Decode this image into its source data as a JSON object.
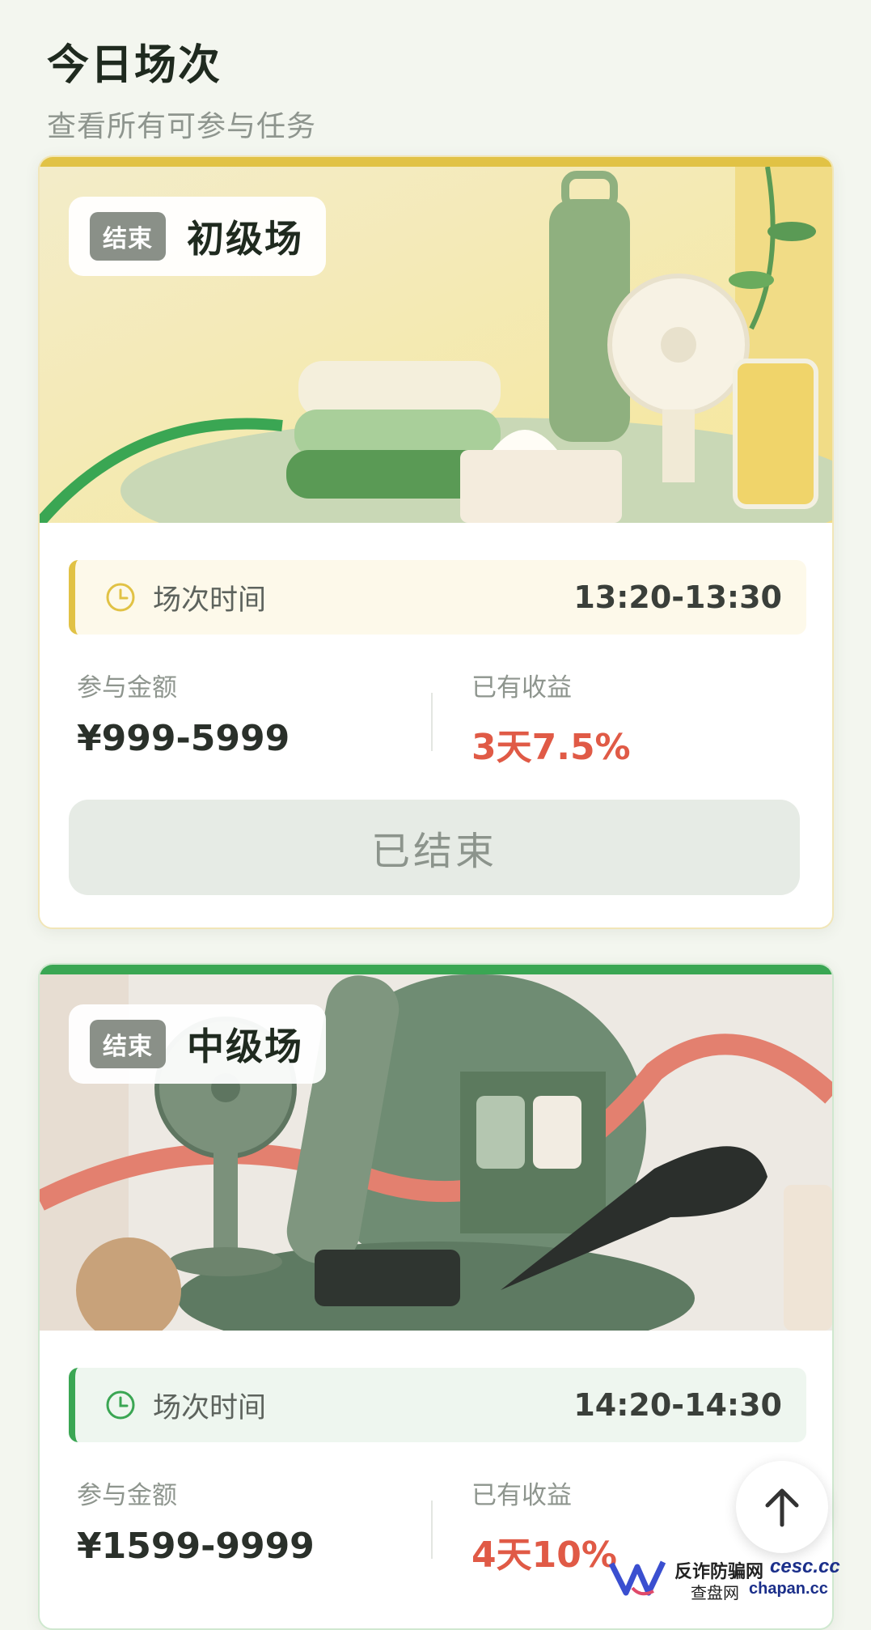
{
  "header": {
    "title": "今日场次",
    "subtitle": "查看所有可参与任务"
  },
  "sessions": [
    {
      "status_badge": "结束",
      "level": "初级场",
      "time_label": "场次时间",
      "time_value": "13:20-13:30",
      "amount_label": "参与金额",
      "amount_value": "¥999-5999",
      "profit_label": "已有收益",
      "profit_value": "3天7.5%",
      "button_label": "已结束",
      "accent_color": "#e1c245"
    },
    {
      "status_badge": "结束",
      "level": "中级场",
      "time_label": "场次时间",
      "time_value": "14:20-14:30",
      "amount_label": "参与金额",
      "amount_value": "¥1599-9999",
      "profit_label": "已有收益",
      "profit_value": "4天10%",
      "accent_color": "#3aa653"
    }
  ],
  "watermark": {
    "line1_a": "反诈防骗网",
    "line1_b": "cesc.cc",
    "line2_a": "查盘网",
    "line2_b": "chapan.cc"
  },
  "icons": {
    "clock": "clock-icon",
    "back_to_top": "arrow-up-icon"
  },
  "colors": {
    "profit": "#e05a46",
    "gold": "#e1c245",
    "green": "#3aa653"
  }
}
